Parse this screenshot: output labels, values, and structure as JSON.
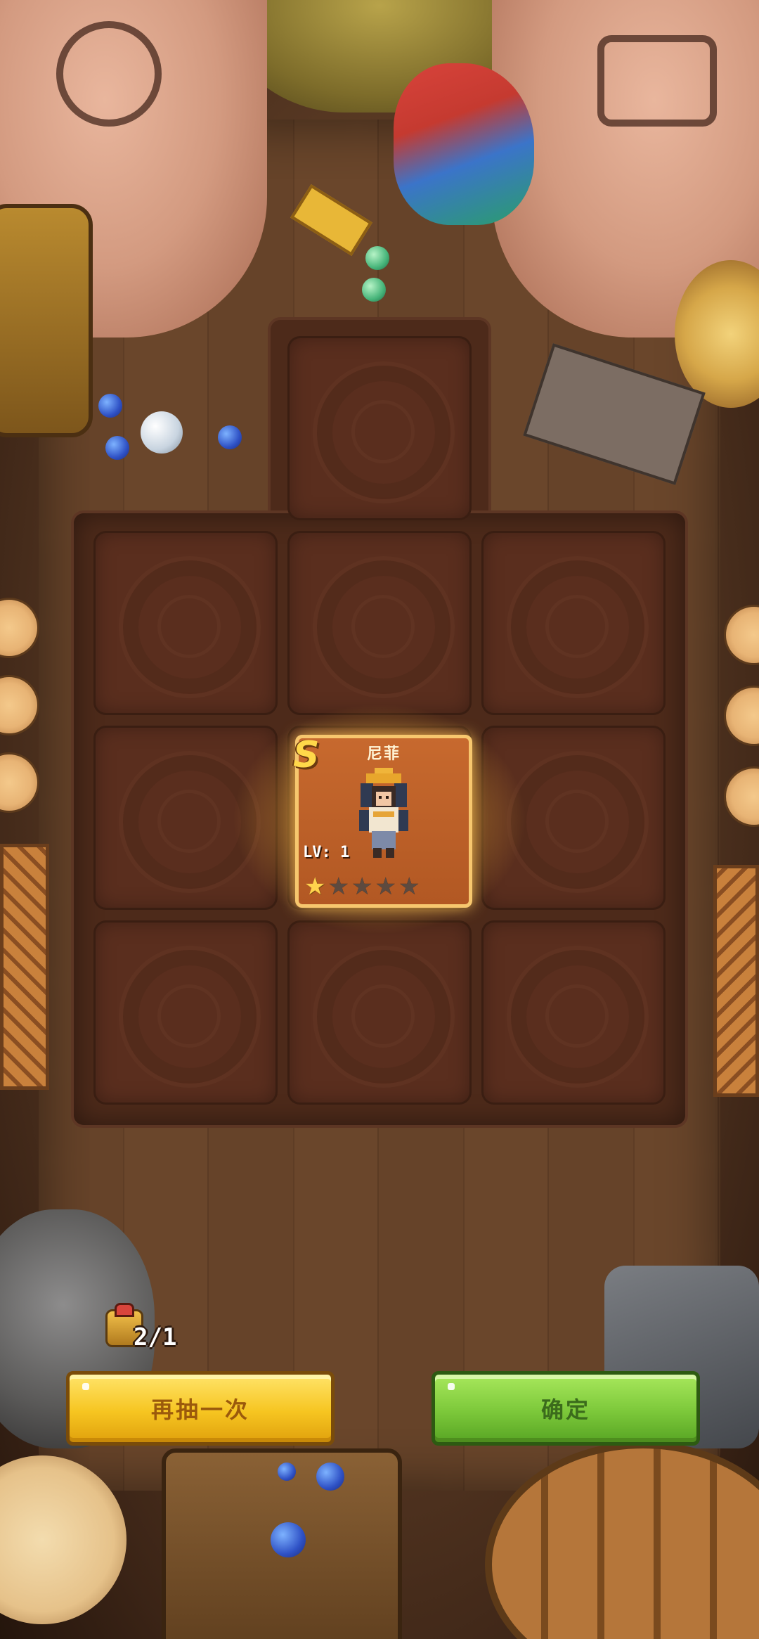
{
  "hero_card": {
    "rank": "S",
    "name": "尼菲",
    "level": "LV: 1",
    "stars_filled": 1,
    "stars_total": 5
  },
  "draw_counter": {
    "text": "2/1",
    "icon": "ticket-icon"
  },
  "buttons": {
    "draw_again": "再抽一次",
    "confirm": "确定"
  },
  "colors": {
    "draw_again_bg": "#f6c521",
    "confirm_bg": "#7cc83a",
    "card_bg": "#c7692e",
    "rank_color": "#ffd84a"
  }
}
